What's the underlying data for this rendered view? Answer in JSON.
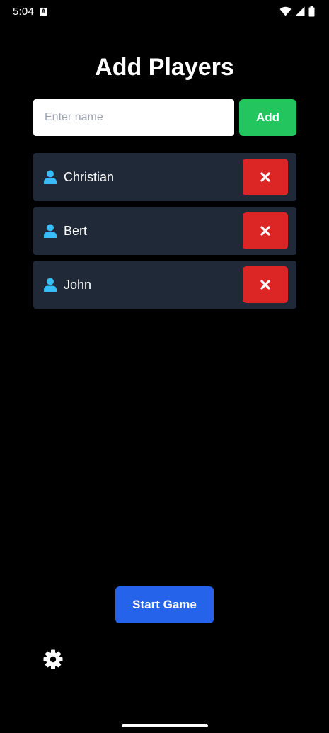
{
  "status_bar": {
    "time": "5:04",
    "notification_badge": "A"
  },
  "title": "Add Players",
  "input": {
    "placeholder": "Enter name",
    "value": ""
  },
  "add_label": "Add",
  "players": [
    {
      "name": "Christian"
    },
    {
      "name": "Bert"
    },
    {
      "name": "John"
    }
  ],
  "start_label": "Start Game",
  "icons": {
    "player": "person-icon",
    "remove": "close-icon",
    "settings": "gear-icon"
  },
  "colors": {
    "background": "#000000",
    "add": "#22c55e",
    "remove": "#dc2626",
    "start": "#2563eb",
    "row": "#1f2937",
    "player_icon": "#38bdf8"
  }
}
